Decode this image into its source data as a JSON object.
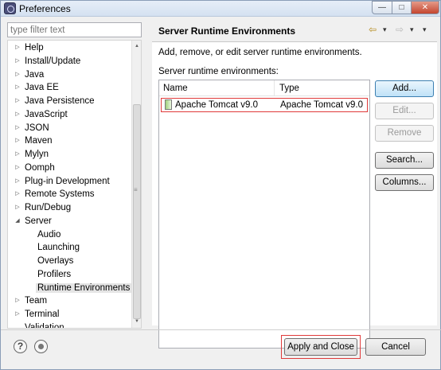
{
  "window": {
    "title": "Preferences",
    "controls": {
      "minimize": "—",
      "maximize": "□",
      "close": "✕"
    }
  },
  "sidebar": {
    "filter_placeholder": "type filter text",
    "items": [
      {
        "label": "Help",
        "expandable": true,
        "expanded": false
      },
      {
        "label": "Install/Update",
        "expandable": true,
        "expanded": false
      },
      {
        "label": "Java",
        "expandable": true,
        "expanded": false
      },
      {
        "label": "Java EE",
        "expandable": true,
        "expanded": false
      },
      {
        "label": "Java Persistence",
        "expandable": true,
        "expanded": false
      },
      {
        "label": "JavaScript",
        "expandable": true,
        "expanded": false
      },
      {
        "label": "JSON",
        "expandable": true,
        "expanded": false
      },
      {
        "label": "Maven",
        "expandable": true,
        "expanded": false
      },
      {
        "label": "Mylyn",
        "expandable": true,
        "expanded": false
      },
      {
        "label": "Oomph",
        "expandable": true,
        "expanded": false
      },
      {
        "label": "Plug-in Development",
        "expandable": true,
        "expanded": false
      },
      {
        "label": "Remote Systems",
        "expandable": true,
        "expanded": false
      },
      {
        "label": "Run/Debug",
        "expandable": true,
        "expanded": false
      },
      {
        "label": "Server",
        "expandable": true,
        "expanded": true
      },
      {
        "label": "Audio",
        "child": true
      },
      {
        "label": "Launching",
        "child": true
      },
      {
        "label": "Overlays",
        "child": true
      },
      {
        "label": "Profilers",
        "child": true
      },
      {
        "label": "Runtime Environments",
        "child": true,
        "selected": true
      },
      {
        "label": "Team",
        "expandable": true,
        "expanded": false
      },
      {
        "label": "Terminal",
        "expandable": true,
        "expanded": false
      },
      {
        "label": "Validation",
        "expandable": false
      }
    ]
  },
  "panel": {
    "title": "Server Runtime Environments",
    "nav": {
      "back": "⇦",
      "back_menu": "▾",
      "forward": "⇨",
      "forward_menu": "▾",
      "view_menu": "▾"
    },
    "description": "Add, remove, or edit server runtime environments.",
    "list_label": "Server runtime environments:",
    "table": {
      "columns": [
        "Name",
        "Type"
      ],
      "rows": [
        {
          "name": "Apache Tomcat v9.0",
          "type": "Apache Tomcat v9.0"
        }
      ]
    },
    "buttons": {
      "add": "Add...",
      "edit": "Edit...",
      "remove": "Remove",
      "search": "Search...",
      "columns": "Columns..."
    }
  },
  "footer": {
    "help_icon": "?",
    "apply_and_close": "Apply and Close",
    "cancel": "Cancel"
  }
}
